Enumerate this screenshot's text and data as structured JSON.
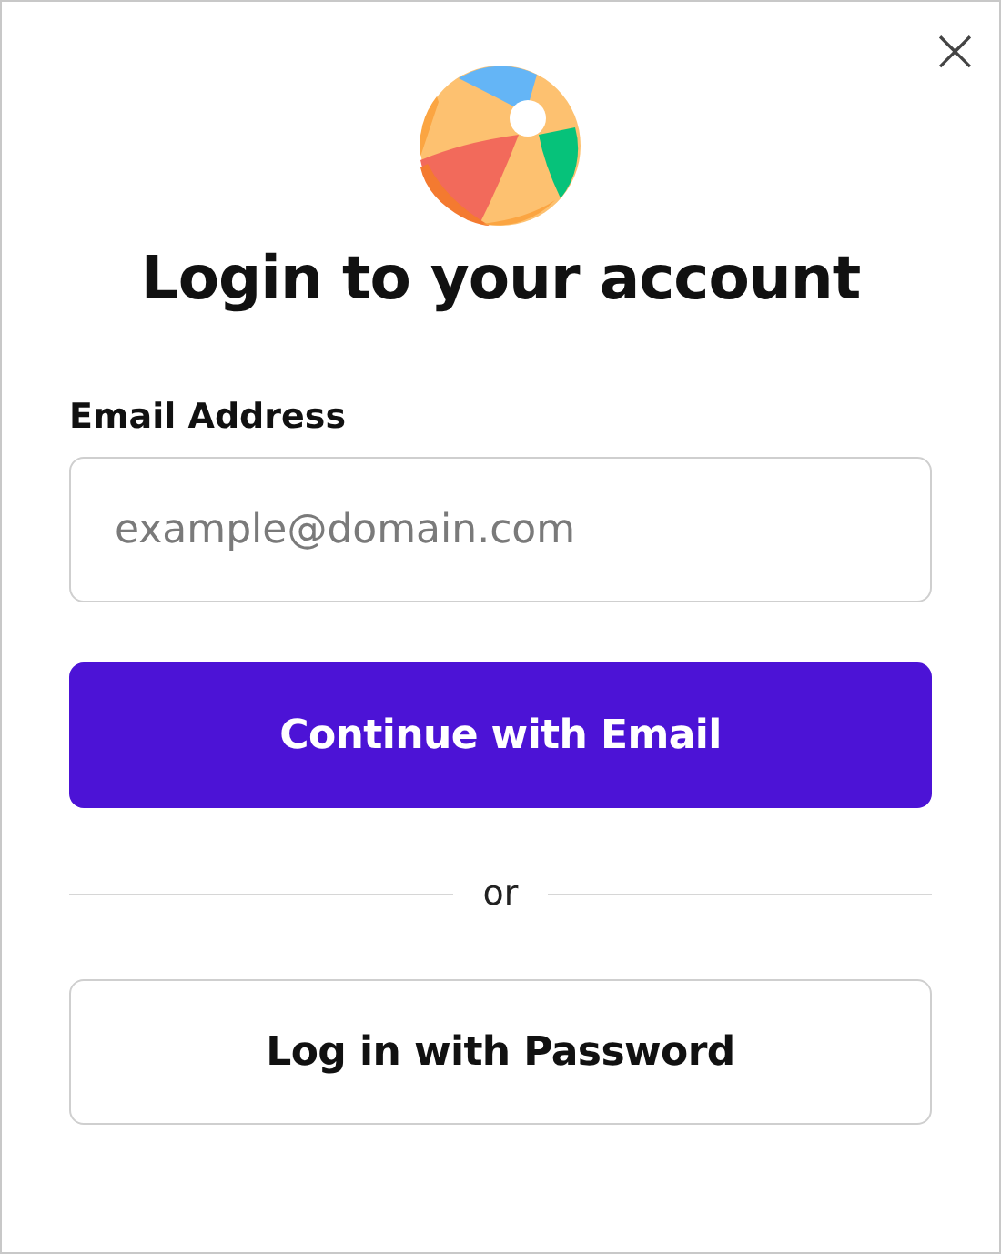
{
  "dialog": {
    "title": "Login to your account",
    "close": "×",
    "email": {
      "label": "Email Address",
      "placeholder": "example@domain.com"
    },
    "primary_button": "Continue with Email",
    "separator": "or",
    "secondary_button": "Log in with Password"
  }
}
